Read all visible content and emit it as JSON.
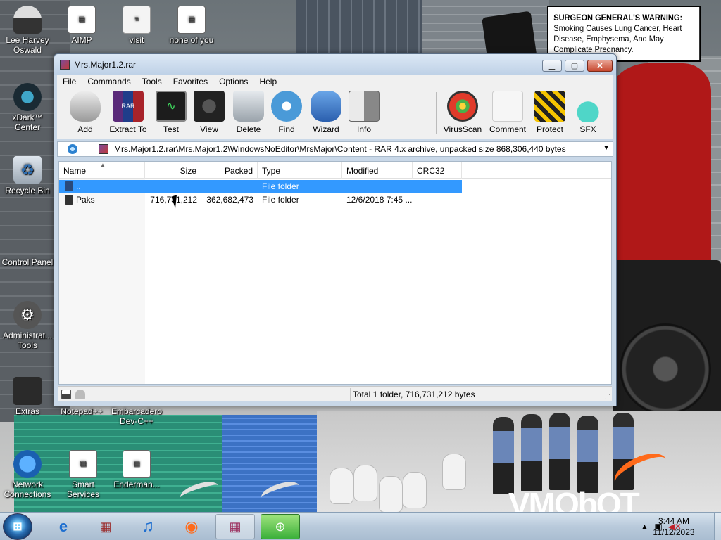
{
  "warning": {
    "heading": "SURGEON GENERAL'S WARNING:",
    "body": "Smoking Causes Lung Cancer, Heart Disease, Emphysema, And May Complicate Pregnancy."
  },
  "background_brand": "VMObOT",
  "desktop_icons": [
    {
      "label": "Lee Harvey Oswald",
      "icon": "person-icon"
    },
    {
      "label": "AIMP",
      "icon": "app-icon"
    },
    {
      "label": "visit",
      "icon": "document-icon"
    },
    {
      "label": "none of you",
      "icon": "app-icon"
    },
    {
      "label": "xDark™ Center",
      "icon": "xdark-icon"
    },
    {
      "label": "Recycle Bin",
      "icon": "recycle-bin-icon"
    },
    {
      "label": "Control Panel",
      "icon": "control-panel-icon"
    },
    {
      "label": "Administrat... Tools",
      "icon": "gear-icon"
    },
    {
      "label": "Extras",
      "icon": "folder-icon"
    },
    {
      "label": "Notepad++",
      "icon": "notepad-icon"
    },
    {
      "label": "Embarcadero Dev-C++",
      "icon": "devcpp-icon"
    },
    {
      "label": "Network Connections",
      "icon": "network-icon"
    },
    {
      "label": "Smart Services",
      "icon": "app-icon"
    },
    {
      "label": "Enderman...",
      "icon": "app-icon"
    }
  ],
  "window": {
    "title": "Mrs.Major1.2.rar",
    "menu": [
      "File",
      "Commands",
      "Tools",
      "Favorites",
      "Options",
      "Help"
    ],
    "toolbar": [
      {
        "label": "Add",
        "icon": "database-icon"
      },
      {
        "label": "Extract To",
        "icon": "rar-books-icon"
      },
      {
        "label": "Test",
        "icon": "monitor-pulse-icon"
      },
      {
        "label": "View",
        "icon": "camera-icon"
      },
      {
        "label": "Delete",
        "icon": "trash-icon"
      },
      {
        "label": "Find",
        "icon": "compass-icon"
      },
      {
        "label": "Wizard",
        "icon": "cat-wizard-icon"
      },
      {
        "label": "Info",
        "icon": "finder-face-icon"
      },
      {
        "label": "VirusScan",
        "icon": "radar-icon"
      },
      {
        "label": "Comment",
        "icon": "note-icon"
      },
      {
        "label": "Protect",
        "icon": "fire-shield-icon"
      },
      {
        "label": "SFX",
        "icon": "flask-icon"
      }
    ],
    "address_path": "Mrs.Major1.2.rar\\Mrs.Major1.2\\WindowsNoEditor\\MrsMajor\\Content - RAR 4.x archive, unpacked size 868,306,440 bytes",
    "columns": [
      "Name",
      "Size",
      "Packed",
      "Type",
      "Modified",
      "CRC32"
    ],
    "rows": [
      {
        "name": "..",
        "size": "",
        "packed": "",
        "type": "File folder",
        "modified": "",
        "crc": "",
        "selected": true
      },
      {
        "name": "Paks",
        "size": "716,731,212",
        "packed": "362,682,473",
        "type": "File folder",
        "modified": "12/6/2018 7:45 ...",
        "crc": "",
        "selected": false
      }
    ],
    "status_text": "Total 1 folder, 716,731,212 bytes"
  },
  "taskbar": {
    "clock_time": "3:44 AM",
    "clock_date": "11/12/2023",
    "apps": [
      "ie-icon",
      "winrar-archive-icon",
      "music-note-icon",
      "firefox-icon",
      "winrar-icon",
      "unreal-icon"
    ]
  },
  "colors": {
    "selection": "#3399ff",
    "title_gradient_top": "#dce8f5",
    "close_button": "#c7482f",
    "taskbar_active": "#3bb03a"
  }
}
